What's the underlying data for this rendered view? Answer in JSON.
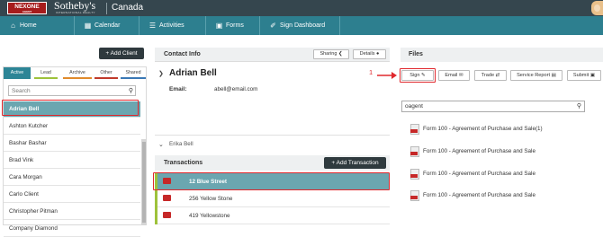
{
  "header": {
    "logo_text": "NEXONE",
    "logo_sub": "AGENT",
    "brand": "Sotheby's",
    "brand_sub": "INTERNATIONAL REALTY",
    "region": "Canada"
  },
  "nav": {
    "tabs": [
      {
        "label": "Home",
        "icon": "home-icon"
      },
      {
        "label": "Calendar",
        "icon": "calendar-icon"
      },
      {
        "label": "Activities",
        "icon": "activities-icon"
      },
      {
        "label": "Forms",
        "icon": "forms-icon"
      },
      {
        "label": "Sign Dashboard",
        "icon": "sign-dashboard-icon"
      }
    ]
  },
  "clients": {
    "add_label": "+ Add Client",
    "filters": [
      "Active",
      "Lead",
      "Archive",
      "Other",
      "Shared"
    ],
    "active_filter": "Active",
    "search_placeholder": "Search",
    "items": [
      "Adrian Bell",
      "Ashton Kutcher",
      "Bashar Bashar",
      "Brad Vink",
      "Cara Morgan",
      "Carlo Client",
      "Christopher Pitman",
      "Company Diamond"
    ],
    "selected": "Adrian Bell"
  },
  "contact": {
    "header": "Contact Info",
    "sharing_label": "Sharing",
    "details_label": "Details",
    "name": "Adrian Bell",
    "email_label": "Email:",
    "email_value": "abell@email.com",
    "secondary_contact": "Erika Bell"
  },
  "transactions": {
    "header": "Transactions",
    "add_label": "+ Add Transaction",
    "items": [
      "12 Blue Street",
      "256 Yellow Stone",
      "419 Yellowstone"
    ],
    "selected": "12 Blue Street"
  },
  "files": {
    "header": "Files",
    "toolbar": [
      {
        "label": "Sign",
        "icon": "pen-icon"
      },
      {
        "label": "Email",
        "icon": "envelope-icon"
      },
      {
        "label": "Trade",
        "icon": "trade-icon"
      },
      {
        "label": "Service Report",
        "icon": "report-icon"
      },
      {
        "label": "Submit",
        "icon": "submit-icon"
      }
    ],
    "search_value": "oagent",
    "items": [
      "Form 100 - Agreement of Purchase and Sale(1)",
      "Form 100 - Agreement of Purchase and Sale",
      "Form 100 - Agreement of Purchase and Sale",
      "Form 100 - Agreement of Purchase and Sale"
    ]
  },
  "annotation": {
    "step_number": "1",
    "color": "#e0282d"
  },
  "colors": {
    "topbar": "#35464e",
    "nav": "#2d7f8f",
    "selected_row": "#6ba6b0",
    "logo": "#a61c1c"
  }
}
